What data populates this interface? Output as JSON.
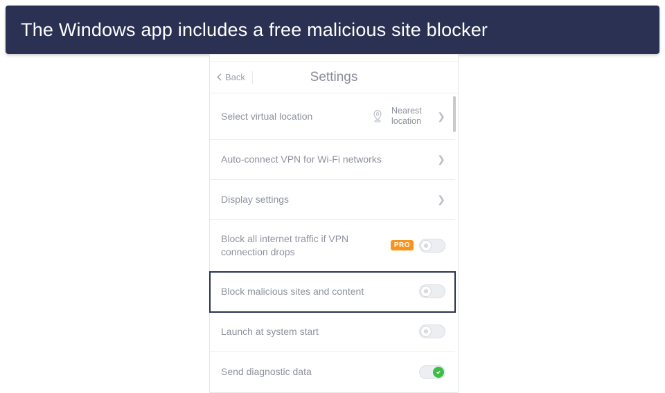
{
  "caption": "The Windows app includes a free malicious site blocker",
  "header": {
    "back": "Back",
    "title": "Settings"
  },
  "rows": {
    "r0": {
      "label": "Select virtual location",
      "value": "Nearest location"
    },
    "r1": {
      "label": "Auto-connect VPN for Wi-Fi networks"
    },
    "r2": {
      "label": "Display settings"
    },
    "r3": {
      "label": "Block all internet traffic if VPN connection drops",
      "badge": "PRO"
    },
    "r4": {
      "label": "Block malicious sites and content"
    },
    "r5": {
      "label": "Launch at system start"
    },
    "r6": {
      "label": "Send diagnostic data"
    }
  }
}
